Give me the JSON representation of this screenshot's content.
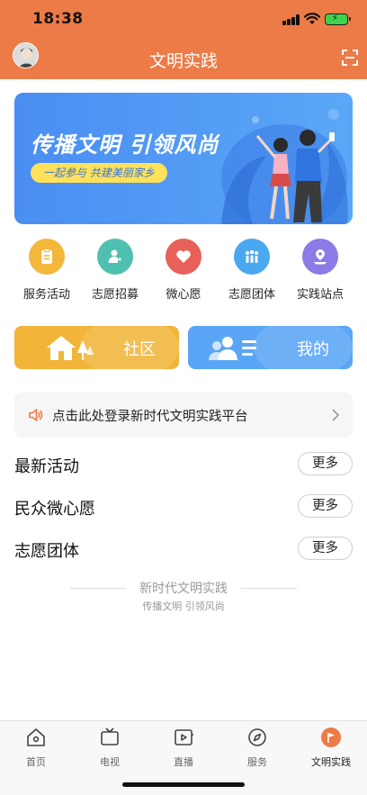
{
  "status_bar": {
    "time": "18:38"
  },
  "nav": {
    "title": "文明实践"
  },
  "banner": {
    "title": "传播文明 引领风尚",
    "subtitle": "一起参与 共建美丽家乡"
  },
  "quick_actions": [
    {
      "label": "服务活动",
      "color": "#f3b73c",
      "icon": "clipboard-icon"
    },
    {
      "label": "志愿招募",
      "color": "#4fc0b0",
      "icon": "volunteer-icon"
    },
    {
      "label": "微心愿",
      "color": "#e8605a",
      "icon": "heart-icon"
    },
    {
      "label": "志愿团体",
      "color": "#4aa8f0",
      "icon": "group-icon"
    },
    {
      "label": "实践站点",
      "color": "#8a7be6",
      "icon": "location-icon"
    }
  ],
  "entries": {
    "community": {
      "label": "社区",
      "color": "#f2b53a"
    },
    "mine": {
      "label": "我的",
      "color": "#5aa5f5"
    }
  },
  "notice": {
    "text": "点击此处登录新时代文明实践平台"
  },
  "sections": [
    {
      "title": "最新活动",
      "more": "更多"
    },
    {
      "title": "民众微心愿",
      "more": "更多"
    },
    {
      "title": "志愿团体",
      "more": "更多"
    }
  ],
  "footer": {
    "title": "新时代文明实践",
    "subtitle": "传播文明 引领风尚"
  },
  "tabs": [
    {
      "label": "首页",
      "icon": "home-icon",
      "active": false
    },
    {
      "label": "电视",
      "icon": "tv-icon",
      "active": false
    },
    {
      "label": "直播",
      "icon": "live-icon",
      "active": false
    },
    {
      "label": "服务",
      "icon": "compass-icon",
      "active": false
    },
    {
      "label": "文明实践",
      "icon": "flag-icon",
      "active": true
    }
  ],
  "colors": {
    "header": "#ed7b47",
    "accent": "#ed7b47"
  }
}
